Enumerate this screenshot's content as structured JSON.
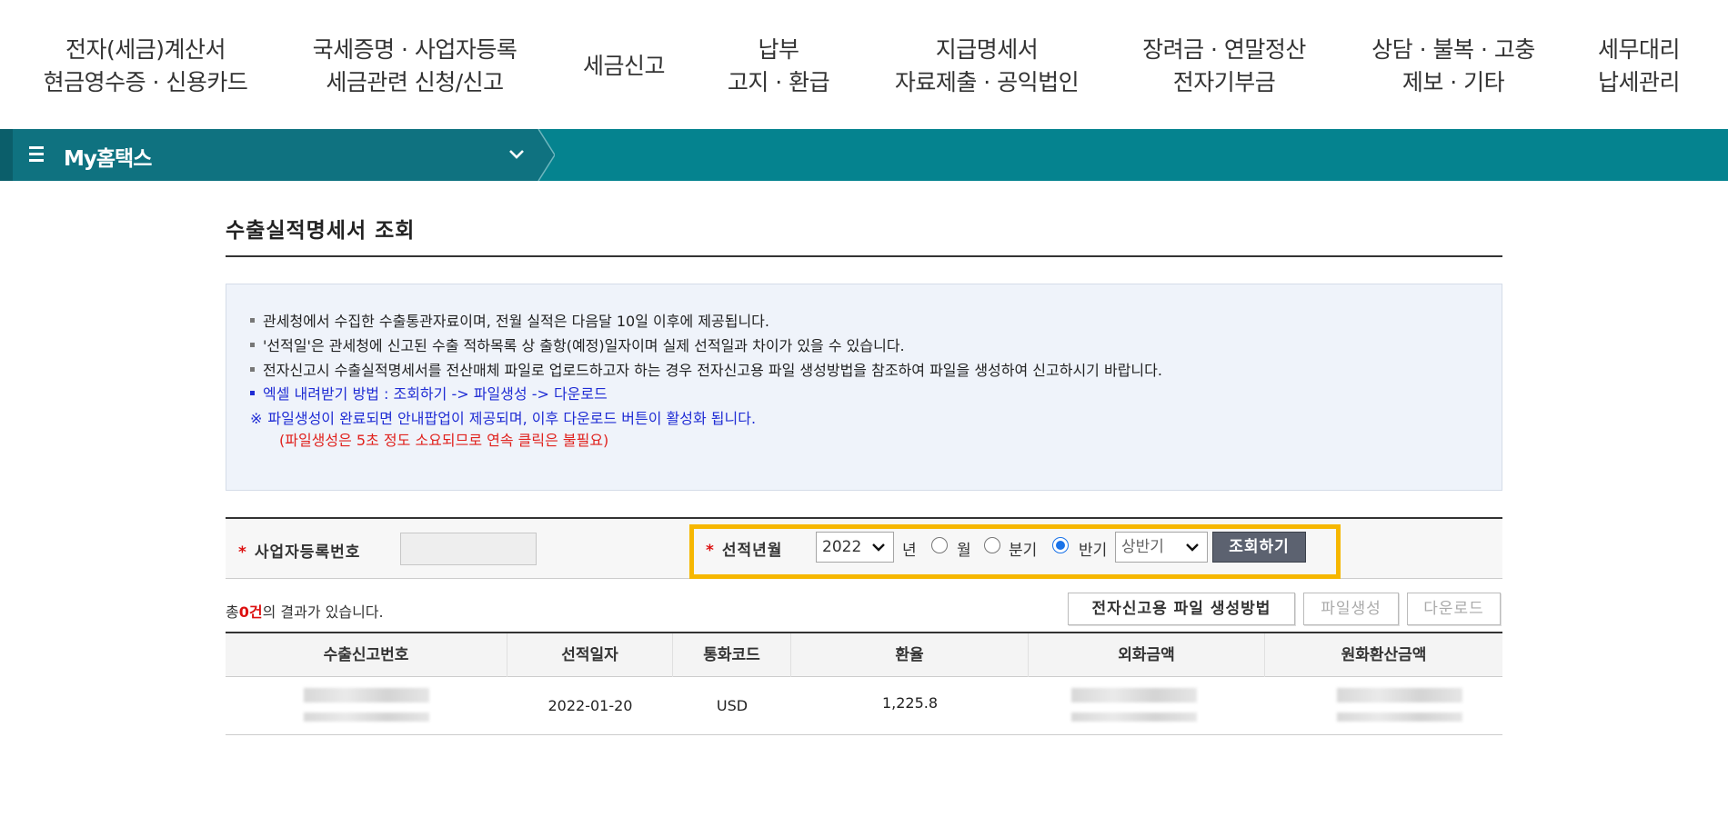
{
  "top_nav": [
    {
      "line1": "전자(세금)계산서",
      "line2": "현금영수증 · 신용카드"
    },
    {
      "line1": "국세증명 · 사업자등록",
      "line2": "세금관련 신청/신고"
    },
    {
      "line1": "세금신고",
      "line2": ""
    },
    {
      "line1": "납부",
      "line2": "고지 · 환급"
    },
    {
      "line1": "지급명세서",
      "line2": "자료제출 · 공익법인"
    },
    {
      "line1": "장려금 · 연말정산",
      "line2": "전자기부금"
    },
    {
      "line1": "상담 · 불복 · 고충",
      "line2": "제보 · 기타"
    },
    {
      "line1": "세무대리",
      "line2": "납세관리"
    }
  ],
  "my_bar": {
    "title": "My홈택스",
    "color": "#05838f"
  },
  "page": {
    "title": "수출실적명세서 조회"
  },
  "notice": {
    "line1": "관세청에서 수집한 수출통관자료이며, 전월 실적은 다음달 10일 이후에 제공됩니다.",
    "line2": "'선적일'은 관세청에 신고된 수출 적하목록 상 출항(예정)일자이며 실제 선적일과 차이가 있을 수 있습니다.",
    "line3": "전자신고시 수출실적명세서를 전산매체 파일로 업로드하고자 하는 경우 전자신고용 파일 생성방법을 참조하여 파일을 생성하여 신고하시기 바랍니다.",
    "line4": "엑셀 내려받기 방법 :  조회하기 ->  파일생성 -> 다운로드",
    "line5_star": "※",
    "line5": "파일생성이 완료되면 안내팝업이 제공되며, 이후  다운로드 버튼이 활성화 됩니다.",
    "line6": "(파일생성은 5초 정도 소요되므로 연속 클릭은 불필요)"
  },
  "search": {
    "required_mark": "*",
    "biz_label": "사업자등록번호",
    "ship_label": "선적년월",
    "year_value": "2022",
    "year_suffix": "년",
    "radio_month": "월",
    "radio_quarter": "분기",
    "radio_half": "반기",
    "selected_period": "반기",
    "half_value": "상반기",
    "search_button": "조회하기"
  },
  "results": {
    "prefix": "총",
    "count": "0건",
    "suffix": "의 결과가 있습니다."
  },
  "buttons": {
    "file_method": "전자신고용 파일 생성방법",
    "file_create": "파일생성",
    "download": "다운로드"
  },
  "table": {
    "headers": [
      "수출신고번호",
      "선적일자",
      "통화코드",
      "환율",
      "외화금액",
      "원화환산금액"
    ],
    "rows": [
      {
        "ship_date": "2022-01-20",
        "currency": "USD",
        "rate": "1,225.8"
      }
    ]
  },
  "colors": {
    "accent": "#05838f",
    "highlight": "#f6b700",
    "required": "#dd1111",
    "notice_blue": "#1f2cd4",
    "notice_red": "#e0221e"
  }
}
